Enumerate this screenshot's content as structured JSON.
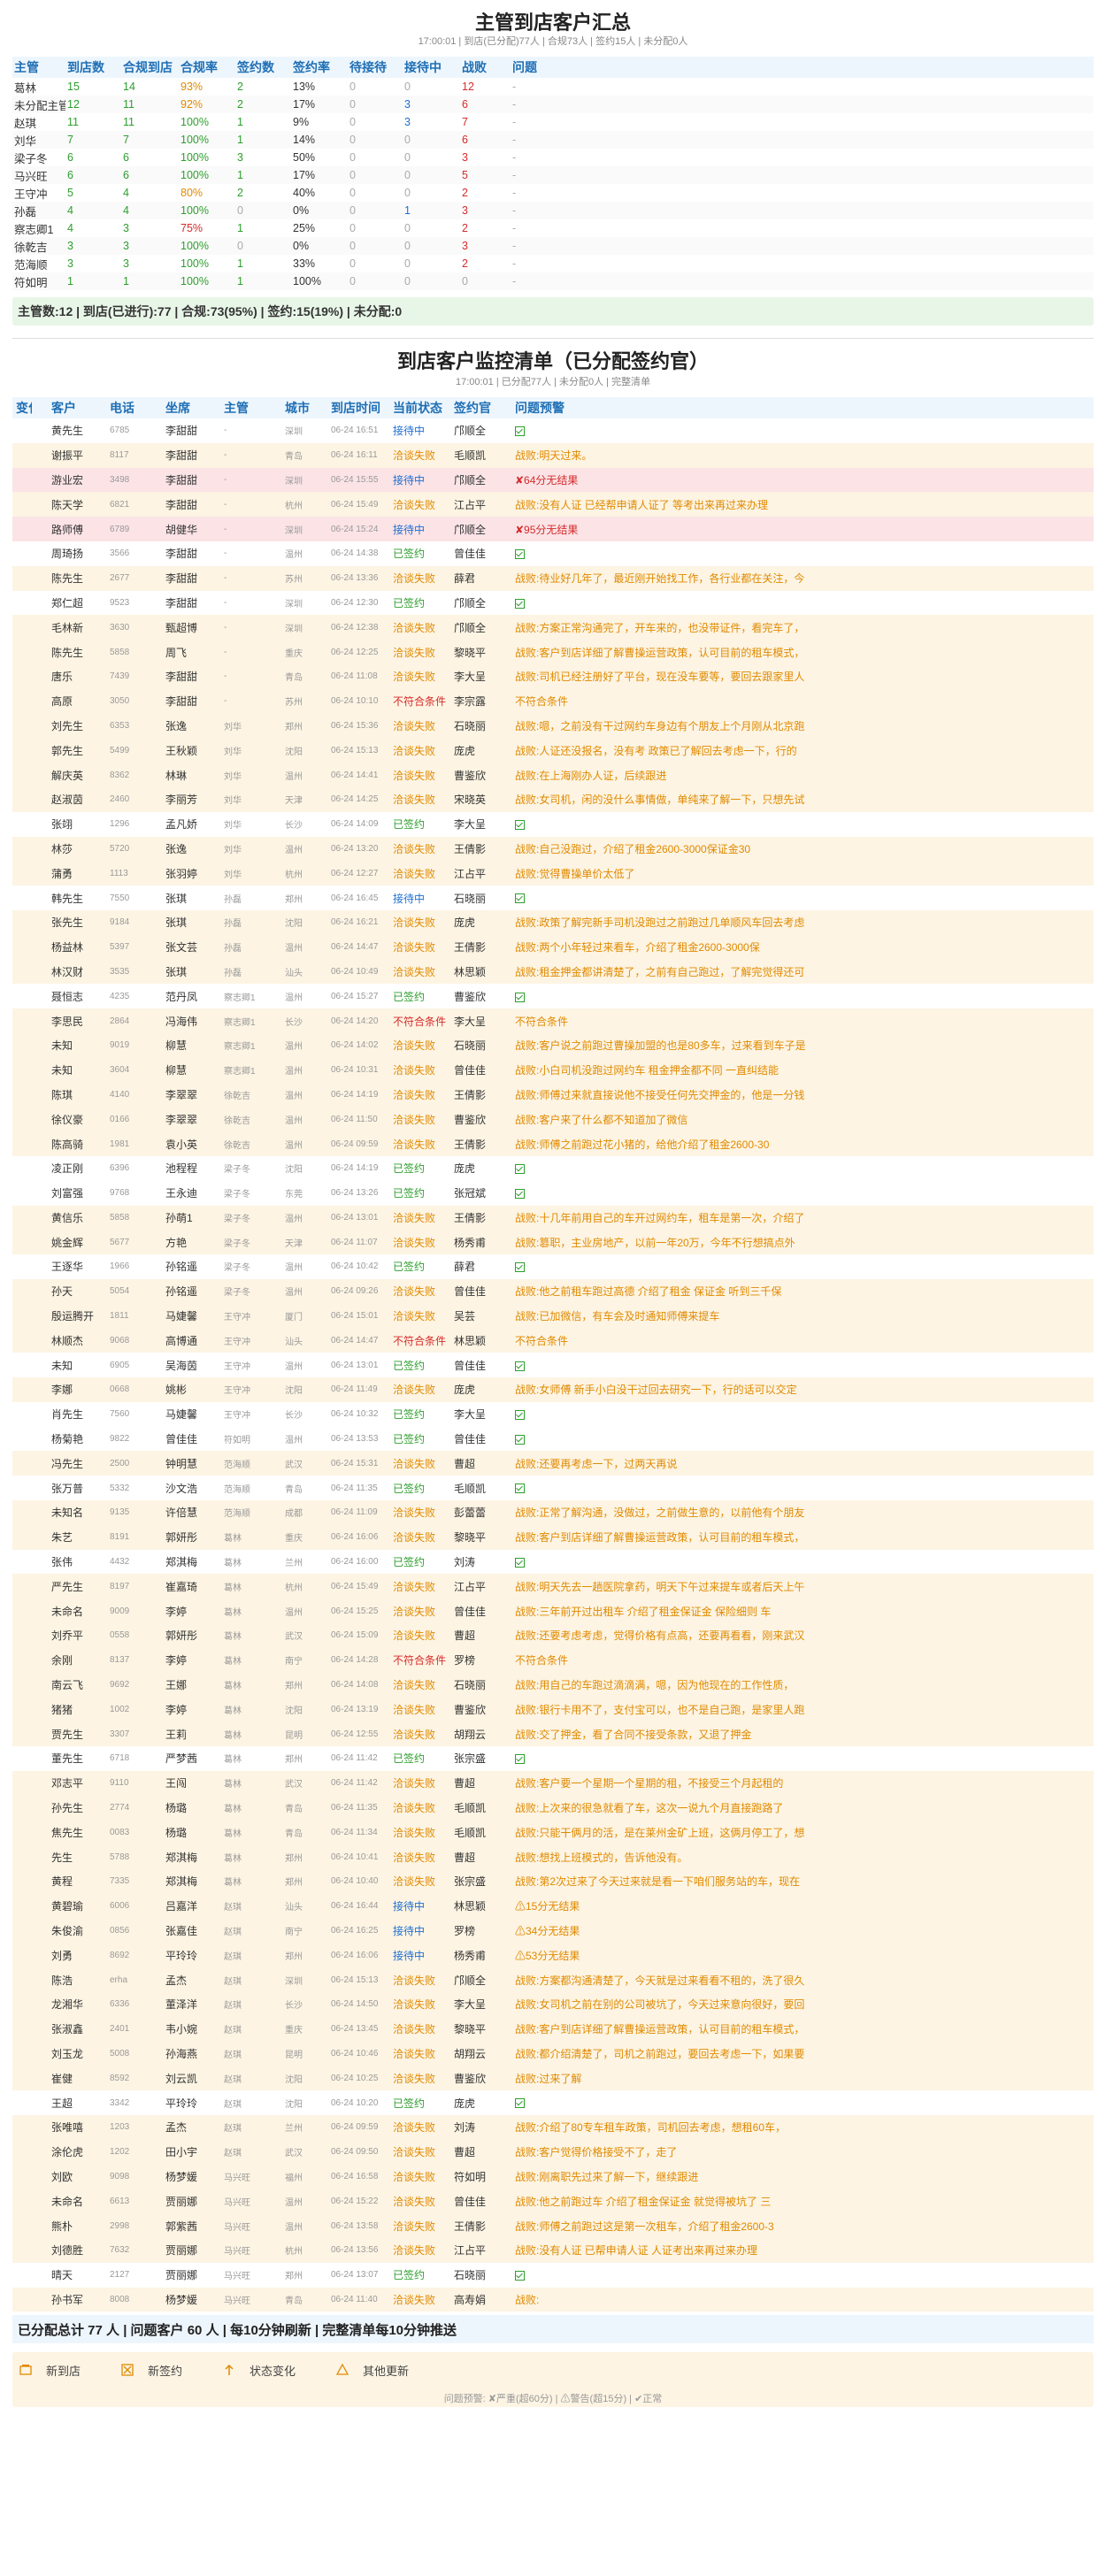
{
  "summary": {
    "title": "主管到店客户汇总",
    "subtitle": "17:00:01 | 到店(已分配)77人 | 合规73人 | 签约15人 | 未分配0人",
    "headers": [
      "主管",
      "到店数",
      "合规到店",
      "合规率",
      "签约数",
      "签约率",
      "待接待",
      "接待中",
      "战败",
      "问题"
    ],
    "rows": [
      [
        "葛林",
        "15",
        "14",
        "93%",
        "2",
        "13%",
        "0",
        "0",
        "12",
        "-"
      ],
      [
        "未分配主管",
        "12",
        "11",
        "92%",
        "2",
        "17%",
        "0",
        "3",
        "6",
        "-"
      ],
      [
        "赵琪",
        "11",
        "11",
        "100%",
        "1",
        "9%",
        "0",
        "3",
        "7",
        "-"
      ],
      [
        "刘华",
        "7",
        "7",
        "100%",
        "1",
        "14%",
        "0",
        "0",
        "6",
        "-"
      ],
      [
        "梁子冬",
        "6",
        "6",
        "100%",
        "3",
        "50%",
        "0",
        "0",
        "3",
        "-"
      ],
      [
        "马兴旺",
        "6",
        "6",
        "100%",
        "1",
        "17%",
        "0",
        "0",
        "5",
        "-"
      ],
      [
        "王守冲",
        "5",
        "4",
        "80%",
        "2",
        "40%",
        "0",
        "0",
        "2",
        "-"
      ],
      [
        "孙磊",
        "4",
        "4",
        "100%",
        "0",
        "0%",
        "0",
        "1",
        "3",
        "-"
      ],
      [
        "察志卿1",
        "4",
        "3",
        "75%",
        "1",
        "25%",
        "0",
        "0",
        "2",
        "-"
      ],
      [
        "徐乾吉",
        "3",
        "3",
        "100%",
        "0",
        "0%",
        "0",
        "0",
        "3",
        "-"
      ],
      [
        "范海顺",
        "3",
        "3",
        "100%",
        "1",
        "33%",
        "0",
        "0",
        "2",
        "-"
      ],
      [
        "符如明",
        "1",
        "1",
        "100%",
        "1",
        "100%",
        "0",
        "0",
        "0",
        "-"
      ]
    ],
    "totals": "主管数:12 | 到店(已进行):77 | 合规:73(95%) | 签约:15(19%) | 未分配:0"
  },
  "monitor": {
    "title": "到店客户监控清单（已分配签约官）",
    "subtitle": "17:00:01 | 已分配77人 | 未分配0人 | 完整清单",
    "headers": [
      "变化",
      "客户",
      "电话",
      "坐席",
      "主管",
      "城市",
      "到店时间",
      "当前状态",
      "签约官",
      "问题预警"
    ],
    "rows": [
      [
        "黄先生",
        "6785",
        "李甜甜",
        "-",
        "深圳",
        "06-24 16:51",
        "接待中",
        "邝顺全",
        "✔",
        ""
      ],
      [
        "谢振平",
        "8117",
        "李甜甜",
        "-",
        "青岛",
        "06-24 16:11",
        "洽谈失败",
        "毛顺凯",
        "战败:明天过来。",
        "w"
      ],
      [
        "游业宏",
        "3498",
        "李甜甜",
        "-",
        "深圳",
        "06-24 15:55",
        "接待中",
        "邝顺全",
        "✘64分无结果",
        "a"
      ],
      [
        "陈天学",
        "6821",
        "李甜甜",
        "-",
        "杭州",
        "06-24 15:49",
        "洽谈失败",
        "江占平",
        "战败:没有人证 已经帮申请人证了 等考出来再过来办理",
        "w"
      ],
      [
        "路师傅",
        "6789",
        "胡健华",
        "-",
        "深圳",
        "06-24 15:24",
        "接待中",
        "邝顺全",
        "✘95分无结果",
        "a"
      ],
      [
        "周琦扬",
        "3566",
        "李甜甜",
        "-",
        "温州",
        "06-24 14:38",
        "已签约",
        "曾佳佳",
        "✔",
        ""
      ],
      [
        "陈先生",
        "2677",
        "李甜甜",
        "-",
        "苏州",
        "06-24 13:36",
        "洽谈失败",
        "薛君",
        "战败:待业好几年了，最近刚开始找工作，各行业都在关注，今",
        "w"
      ],
      [
        "郑仁超",
        "9523",
        "李甜甜",
        "-",
        "深圳",
        "06-24 12:30",
        "已签约",
        "邝顺全",
        "✔",
        ""
      ],
      [
        "毛林新",
        "3630",
        "甄超博",
        "-",
        "深圳",
        "06-24 12:38",
        "洽谈失败",
        "邝顺全",
        "战败:方案正常沟通完了，开车来的，也没带证件，看完车了，",
        "w"
      ],
      [
        "陈先生",
        "5858",
        "周飞",
        "-",
        "重庆",
        "06-24 12:25",
        "洽谈失败",
        "黎晓平",
        "战败:客户到店详细了解曹操运营政策，认可目前的租车模式，",
        "w"
      ],
      [
        "唐乐",
        "7439",
        "李甜甜",
        "-",
        "青岛",
        "06-24 11:08",
        "洽谈失败",
        "李大呈",
        "战败:司机已经注册好了平台，现在没车要等，要回去跟家里人",
        "w"
      ],
      [
        "高原",
        "3050",
        "李甜甜",
        "-",
        "苏州",
        "06-24 10:10",
        "不符合条件",
        "李宗露",
        "不符合条件",
        "w"
      ],
      [
        "刘先生",
        "6353",
        "张逸",
        "刘华",
        "郑州",
        "06-24 15:36",
        "洽谈失败",
        "石晓丽",
        "战败:嗯，之前没有干过网约车身边有个朋友上个月刚从北京跑",
        "w"
      ],
      [
        "郭先生",
        "5499",
        "王秋颖",
        "刘华",
        "沈阳",
        "06-24 15:13",
        "洽谈失败",
        "庞虎",
        "战败:人证还没报名，没有考 政策已了解回去考虑一下，行的",
        "w"
      ],
      [
        "解庆英",
        "8362",
        "林琳",
        "刘华",
        "温州",
        "06-24 14:41",
        "洽谈失败",
        "曹鉴欣",
        "战败:在上海刚办人证，后续跟进",
        "w"
      ],
      [
        "赵淑茵",
        "2460",
        "李丽芳",
        "刘华",
        "天津",
        "06-24 14:25",
        "洽谈失败",
        "宋晓英",
        "战败:女司机，闲的没什么事情做，单纯来了解一下，只想先试",
        "w"
      ],
      [
        "张翊",
        "1296",
        "孟凡娇",
        "刘华",
        "长沙",
        "06-24 14:09",
        "已签约",
        "李大呈",
        "✔",
        ""
      ],
      [
        "林莎",
        "5720",
        "张逸",
        "刘华",
        "温州",
        "06-24 13:20",
        "洽谈失败",
        "王倩影",
        "战败:自己没跑过，介绍了租金2600-3000保证金30",
        "w"
      ],
      [
        "蒲勇",
        "1113",
        "张羽婷",
        "刘华",
        "杭州",
        "06-24 12:27",
        "洽谈失败",
        "江占平",
        "战败:觉得曹操单价太低了",
        "w"
      ],
      [
        "韩先生",
        "7550",
        "张琪",
        "孙磊",
        "郑州",
        "06-24 16:45",
        "接待中",
        "石晓丽",
        "✔",
        ""
      ],
      [
        "张先生",
        "9184",
        "张琪",
        "孙磊",
        "沈阳",
        "06-24 16:21",
        "洽谈失败",
        "庞虎",
        "战败:政策了解完新手司机没跑过之前跑过几单顺风车回去考虑",
        "w"
      ],
      [
        "杨益林",
        "5397",
        "张文芸",
        "孙磊",
        "温州",
        "06-24 14:47",
        "洽谈失败",
        "王倩影",
        "战败:两个小年轻过来看车，介绍了租金2600-3000保",
        "w"
      ],
      [
        "林汉财",
        "3535",
        "张琪",
        "孙磊",
        "汕头",
        "06-24 10:49",
        "洽谈失败",
        "林思颖",
        "战败:租金押金都讲清楚了，之前有自己跑过，了解完觉得还可",
        "w"
      ],
      [
        "聂恒志",
        "4235",
        "范丹凤",
        "察志卿1",
        "温州",
        "06-24 15:27",
        "已签约",
        "曹鉴欣",
        "✔",
        ""
      ],
      [
        "李思民",
        "2864",
        "冯海伟",
        "察志卿1",
        "长沙",
        "06-24 14:20",
        "不符合条件",
        "李大呈",
        "不符合条件",
        "w"
      ],
      [
        "未知",
        "9019",
        "柳慧",
        "察志卿1",
        "温州",
        "06-24 14:02",
        "洽谈失败",
        "石晓丽",
        "战败:客户说之前跑过曹操加盟的也是80多车，过来看到车子是",
        "w"
      ],
      [
        "未知",
        "3604",
        "柳慧",
        "察志卿1",
        "温州",
        "06-24 10:31",
        "洽谈失败",
        "曾佳佳",
        "战败:小白司机没跑过网约车 租金押金都不同 一直纠结能",
        "w"
      ],
      [
        "陈琪",
        "4140",
        "李翠翠",
        "徐乾吉",
        "温州",
        "06-24 14:19",
        "洽谈失败",
        "王倩影",
        "战败:师傅过来就直接说他不接受任何先交押金的，他是一分钱",
        "w"
      ],
      [
        "徐仪豪",
        "0166",
        "李翠翠",
        "徐乾吉",
        "温州",
        "06-24 11:50",
        "洽谈失败",
        "曹鉴欣",
        "战败:客户来了什么都不知道加了微信",
        "w"
      ],
      [
        "陈高骑",
        "1981",
        "袁小英",
        "徐乾吉",
        "温州",
        "06-24 09:59",
        "洽谈失败",
        "王倩影",
        "战败:师傅之前跑过花小猪的，给他介绍了租金2600-30",
        "w"
      ],
      [
        "凌正刚",
        "6396",
        "池程程",
        "梁子冬",
        "沈阳",
        "06-24 14:19",
        "已签约",
        "庞虎",
        "✔",
        ""
      ],
      [
        "刘富强",
        "9768",
        "王永迪",
        "梁子冬",
        "东莞",
        "06-24 13:26",
        "已签约",
        "张冠斌",
        "✔",
        ""
      ],
      [
        "黄信乐",
        "5858",
        "孙萌1",
        "梁子冬",
        "温州",
        "06-24 13:01",
        "洽谈失败",
        "王倩影",
        "战败:十几年前用自己的车开过网约车，租车是第一次，介绍了",
        "w"
      ],
      [
        "姚金辉",
        "5677",
        "方艳",
        "梁子冬",
        "天津",
        "06-24 11:07",
        "洽谈失败",
        "杨秀甫",
        "战败:篡职，主业房地产，以前一年20万，今年不行想搞点外",
        "w"
      ],
      [
        "王逐华",
        "1966",
        "孙铭遥",
        "梁子冬",
        "温州",
        "06-24 10:42",
        "已签约",
        "薛君",
        "✔",
        ""
      ],
      [
        "孙天",
        "5054",
        "孙铭遥",
        "梁子冬",
        "温州",
        "06-24 09:26",
        "洽谈失败",
        "曾佳佳",
        "战败:他之前租车跑过高德 介绍了租金 保证金 听到三千保",
        "w"
      ],
      [
        "殷运腾开",
        "1811",
        "马婕馨",
        "王守冲",
        "厦门",
        "06-24 15:01",
        "洽谈失败",
        "吴芸",
        "战败:已加微信，有车会及时通知师傅来提车",
        "w"
      ],
      [
        "林顺杰",
        "9068",
        "高博通",
        "王守冲",
        "汕头",
        "06-24 14:47",
        "不符合条件",
        "林思颖",
        "不符合条件",
        "w"
      ],
      [
        "未知",
        "6905",
        "吴海茵",
        "王守冲",
        "温州",
        "06-24 13:01",
        "已签约",
        "曾佳佳",
        "✔",
        ""
      ],
      [
        "李娜",
        "0668",
        "姚彬",
        "王守冲",
        "沈阳",
        "06-24 11:49",
        "洽谈失败",
        "庞虎",
        "战败:女师傅 新手小白没干过回去研究一下，行的话可以交定",
        "w"
      ],
      [
        "肖先生",
        "7560",
        "马婕馨",
        "王守冲",
        "长沙",
        "06-24 10:32",
        "已签约",
        "李大呈",
        "✔",
        ""
      ],
      [
        "杨菊艳",
        "9822",
        "曾佳佳",
        "符如明",
        "温州",
        "06-24 13:53",
        "已签约",
        "曾佳佳",
        "✔",
        ""
      ],
      [
        "冯先生",
        "2500",
        "钟明慧",
        "范海顺",
        "武汉",
        "06-24 15:31",
        "洽谈失败",
        "曹超",
        "战败:还要再考虑一下，过两天再说",
        "w"
      ],
      [
        "张万普",
        "5332",
        "沙文浩",
        "范海顺",
        "青岛",
        "06-24 11:35",
        "已签约",
        "毛顺凯",
        "✔",
        ""
      ],
      [
        "未知名",
        "9135",
        "许倍慧",
        "范海顺",
        "成都",
        "06-24 11:09",
        "洽谈失败",
        "彭蕾蕾",
        "战败:正常了解沟通，没做过，之前做生意的，以前他有个朋友",
        "w"
      ],
      [
        "朱艺",
        "8191",
        "郭妍彤",
        "葛林",
        "重庆",
        "06-24 16:06",
        "洽谈失败",
        "黎晓平",
        "战败:客户到店详细了解曹操运营政策，认可目前的租车模式，",
        "w"
      ],
      [
        "张伟",
        "4432",
        "郑淇梅",
        "葛林",
        "兰州",
        "06-24 16:00",
        "已签约",
        "刘涛",
        "✔",
        ""
      ],
      [
        "严先生",
        "8197",
        "崔嘉琦",
        "葛林",
        "杭州",
        "06-24 15:49",
        "洽谈失败",
        "江占平",
        "战败:明天先去一趟医院拿药，明天下午过来提车或者后天上午",
        "w"
      ],
      [
        "未命名",
        "9009",
        "李婷",
        "葛林",
        "温州",
        "06-24 15:25",
        "洽谈失败",
        "曾佳佳",
        "战败:三年前开过出租车 介绍了租金保证金 保险细则 车",
        "w"
      ],
      [
        "刘乔平",
        "0558",
        "郭妍彤",
        "葛林",
        "武汉",
        "06-24 15:09",
        "洽谈失败",
        "曹超",
        "战败:还要考虑考虑，觉得价格有点高，还要再看看，刚来武汉",
        "w"
      ],
      [
        "余刚",
        "8137",
        "李婷",
        "葛林",
        "南宁",
        "06-24 14:28",
        "不符合条件",
        "罗榜",
        "不符合条件",
        "w"
      ],
      [
        "南云飞",
        "9692",
        "王娜",
        "葛林",
        "郑州",
        "06-24 14:08",
        "洽谈失败",
        "石晓丽",
        "战败:用自己的车跑过滴滴满，嗯，因为他现在的工作性质，",
        "w"
      ],
      [
        "猪猪",
        "1002",
        "李婷",
        "葛林",
        "沈阳",
        "06-24 13:19",
        "洽谈失败",
        "曹鉴欣",
        "战败:银行卡用不了，支付宝可以，也不是自己跑，是家里人跑",
        "w"
      ],
      [
        "贾先生",
        "3307",
        "王莉",
        "葛林",
        "昆明",
        "06-24 12:55",
        "洽谈失败",
        "胡翔云",
        "战败:交了押金，看了合同不接受条款，又退了押金",
        "w"
      ],
      [
        "董先生",
        "6718",
        "严梦茜",
        "葛林",
        "郑州",
        "06-24 11:42",
        "已签约",
        "张宗盛",
        "✔",
        ""
      ],
      [
        "邓志平",
        "9110",
        "王闯",
        "葛林",
        "武汉",
        "06-24 11:42",
        "洽谈失败",
        "曹超",
        "战败:客户要一个星期一个星期的租，不接受三个月起租的",
        "w"
      ],
      [
        "孙先生",
        "2774",
        "杨璐",
        "葛林",
        "青岛",
        "06-24 11:35",
        "洽谈失败",
        "毛顺凯",
        "战败:上次来的很急就看了车，这次一说九个月直接跑路了",
        "w"
      ],
      [
        "焦先生",
        "0083",
        "杨璐",
        "葛林",
        "青岛",
        "06-24 11:34",
        "洽谈失败",
        "毛顺凯",
        "战败:只能干俩月的活，是在莱州金矿上班，这俩月停工了，想",
        "w"
      ],
      [
        "先生",
        "5788",
        "郑淇梅",
        "葛林",
        "郑州",
        "06-24 10:41",
        "洽谈失败",
        "曹超",
        "战败:想找上班模式的，告诉他没有。",
        "w"
      ],
      [
        "黄程",
        "7335",
        "郑淇梅",
        "葛林",
        "郑州",
        "06-24 10:40",
        "洽谈失败",
        "张宗盛",
        "战败:第2次过来了今天过来就是看一下咱们服务站的车，现在",
        "w"
      ],
      [
        "黄碧瑜",
        "6006",
        "吕嘉洋",
        "赵琪",
        "汕头",
        "06-24 16:44",
        "接待中",
        "林思颖",
        "⚠15分无结果",
        "w"
      ],
      [
        "朱俊渝",
        "0856",
        "张嘉佳",
        "赵琪",
        "南宁",
        "06-24 16:25",
        "接待中",
        "罗榜",
        "⚠34分无结果",
        "w"
      ],
      [
        "刘勇",
        "8692",
        "平玲玲",
        "赵琪",
        "郑州",
        "06-24 16:06",
        "接待中",
        "杨秀甫",
        "⚠53分无结果",
        "w"
      ],
      [
        "陈浩",
        "erha",
        "孟杰",
        "赵琪",
        "深圳",
        "06-24 15:13",
        "洽谈失败",
        "邝顺全",
        "战败:方案都沟通清楚了，今天就是过来看看不租的，洗了很久",
        "w"
      ],
      [
        "龙湘华",
        "6336",
        "董泽洋",
        "赵琪",
        "长沙",
        "06-24 14:50",
        "洽谈失败",
        "李大呈",
        "战败:女司机之前在别的公司被坑了，今天过来意向很好，要回",
        "w"
      ],
      [
        "张淑鑫",
        "2401",
        "韦小婉",
        "赵琪",
        "重庆",
        "06-24 13:45",
        "洽谈失败",
        "黎晓平",
        "战败:客户到店详细了解曹操运营政策，认可目前的租车模式，",
        "w"
      ],
      [
        "刘玉龙",
        "5008",
        "孙海燕",
        "赵琪",
        "昆明",
        "06-24 10:46",
        "洽谈失败",
        "胡翔云",
        "战败:都介绍清楚了，司机之前跑过，要回去考虑一下，如果要",
        "w"
      ],
      [
        "崔健",
        "8592",
        "刘云凯",
        "赵琪",
        "沈阳",
        "06-24 10:25",
        "洽谈失败",
        "曹鉴欣",
        "战败:过来了解",
        "w"
      ],
      [
        "王超",
        "3342",
        "平玲玲",
        "赵琪",
        "沈阳",
        "06-24 10:20",
        "已签约",
        "庞虎",
        "✔",
        ""
      ],
      [
        "张唯嘻",
        "1203",
        "孟杰",
        "赵琪",
        "兰州",
        "06-24 09:59",
        "洽谈失败",
        "刘涛",
        "战败:介绍了80专车租车政策，司机回去考虑，想租60车，",
        "w"
      ],
      [
        "涂伦虎",
        "1202",
        "田小宇",
        "赵琪",
        "武汉",
        "06-24 09:50",
        "洽谈失败",
        "曹超",
        "战败:客户觉得价格接受不了，走了",
        "w"
      ],
      [
        "刘欧",
        "9098",
        "杨梦媛",
        "马兴旺",
        "福州",
        "06-24 16:58",
        "洽谈失败",
        "符如明",
        "战败:刚离职先过来了解一下，继续跟进",
        "w"
      ],
      [
        "未命名",
        "6613",
        "贾丽娜",
        "马兴旺",
        "温州",
        "06-24 15:22",
        "洽谈失败",
        "曾佳佳",
        "战败:他之前跑过车 介绍了租金保证金 就觉得被坑了 三",
        "w"
      ],
      [
        "熊朴",
        "2998",
        "郭紫茜",
        "马兴旺",
        "温州",
        "06-24 13:58",
        "洽谈失败",
        "王倩影",
        "战败:师傅之前跑过这是第一次租车，介绍了租金2600-3",
        "w"
      ],
      [
        "刘德胜",
        "7632",
        "贾丽娜",
        "马兴旺",
        "杭州",
        "06-24 13:56",
        "洽谈失败",
        "江占平",
        "战败:没有人证 已帮申请人证 人证考出来再过来办理",
        "w"
      ],
      [
        "晴天",
        "2127",
        "贾丽娜",
        "马兴旺",
        "郑州",
        "06-24 13:07",
        "已签约",
        "石晓丽",
        "✔",
        ""
      ],
      [
        "孙书军",
        "8008",
        "杨梦媛",
        "马兴旺",
        "青岛",
        "06-24 11:40",
        "洽谈失败",
        "高寿娟",
        "战败:",
        "w"
      ]
    ],
    "footer": "已分配总计 77 人 | 问题客户 60 人 | 每10分钟刷新 | 完整清单每10分钟推送",
    "legend": [
      {
        "icon": "new-store-icon",
        "label": "新到店"
      },
      {
        "icon": "new-sign-icon",
        "label": "新签约"
      },
      {
        "icon": "status-change-icon",
        "label": "状态变化"
      },
      {
        "icon": "other-update-icon",
        "label": "其他更新"
      }
    ],
    "legend_note": "问题预警: ✘严重(超60分) | ⚠警告(超15分) | ✔正常"
  },
  "colors": {
    "accent": "#1f6fb5",
    "green": "#2e9e2e",
    "orange": "#e08a00",
    "red": "#d62b2b",
    "blue": "#1f6fd1"
  }
}
